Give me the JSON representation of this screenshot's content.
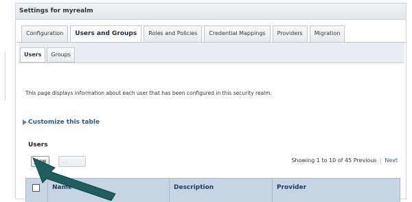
{
  "panel": {
    "title": "Settings for myrealm"
  },
  "tabs": [
    {
      "label": "Configuration",
      "active": false
    },
    {
      "label": "Users and Groups",
      "active": true
    },
    {
      "label": "Roles and Policies",
      "active": false
    },
    {
      "label": "Credential Mappings",
      "active": false
    },
    {
      "label": "Providers",
      "active": false
    },
    {
      "label": "Migration",
      "active": false
    }
  ],
  "subtabs": [
    {
      "label": "Users",
      "active": true
    },
    {
      "label": "Groups",
      "active": false
    }
  ],
  "intro_text": "This page displays information about each user that has been configured in this security realm.",
  "customize_link": "Customize this table",
  "section_title": "Users",
  "toolbar": {
    "new_label": "New",
    "delete_label": "…",
    "paging_text": "Showing 1 to 10 of 45",
    "previous_label": "Previous",
    "next_label": "Next"
  },
  "table": {
    "columns": [
      "Name",
      "Description",
      "Provider"
    ]
  },
  "colors": {
    "header_bg": "#c6d4e4",
    "link": "#2b5d86",
    "arrow": "#1f5e5e"
  },
  "icons": {
    "collapse": "triangle-right-icon",
    "pointer": "pointing-arrow-icon"
  }
}
